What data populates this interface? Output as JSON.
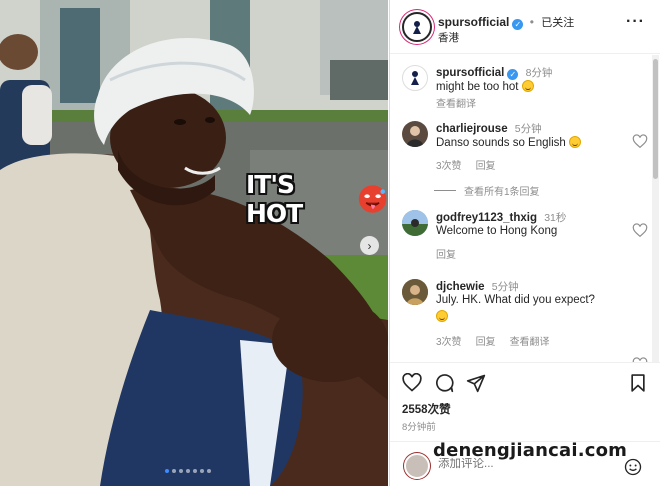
{
  "post": {
    "account": "spursofficial",
    "follow_status": "已关注",
    "location": "香港",
    "media_caption": "IT'S HOT",
    "carousel_count": 7,
    "carousel_active": 1
  },
  "caption_comment": {
    "user": "spursofficial",
    "time": "8分钟",
    "text": "might be too hot",
    "see_translation": "查看翻译"
  },
  "comments": [
    {
      "user": "charliejrouse",
      "time": "5分钟",
      "text": "Danso sounds so English",
      "likes": "3次赞",
      "reply": "回复",
      "view_replies": "查看所有1条回复"
    },
    {
      "user": "godfrey1123_thxig",
      "time": "31秒",
      "text": "Welcome to Hong Kong",
      "reply": "回复"
    },
    {
      "user": "djchewie",
      "time": "5分钟",
      "text": "July. HK. What did you expect?",
      "likes": "3次赞",
      "reply": "回复",
      "see_translation": "查看翻译"
    }
  ],
  "footer": {
    "likes": "2558次赞",
    "posted_ago": "8分钟前",
    "add_comment_placeholder": "添加评论...",
    "watermark": "denengjiancai.com"
  },
  "icons": [
    "heart-icon",
    "comment-icon",
    "share-icon",
    "bookmark-icon",
    "emoji-icon",
    "more-icon",
    "verified-icon",
    "chevron-right-icon"
  ]
}
